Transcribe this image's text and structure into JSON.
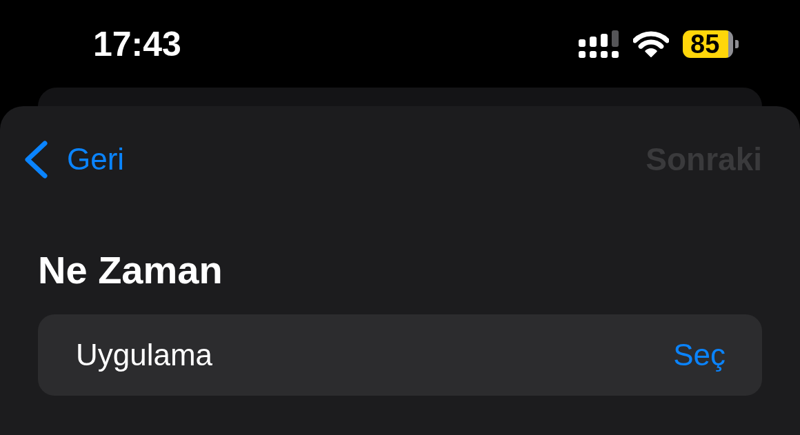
{
  "status_bar": {
    "time": "17:43",
    "battery": "85"
  },
  "nav": {
    "back": {
      "label": "Geri"
    },
    "next": {
      "label": "Sonraki",
      "disabled": true
    }
  },
  "section": {
    "title": "Ne Zaman",
    "rows": [
      {
        "label": "Uygulama",
        "action": "Seç"
      }
    ]
  }
}
